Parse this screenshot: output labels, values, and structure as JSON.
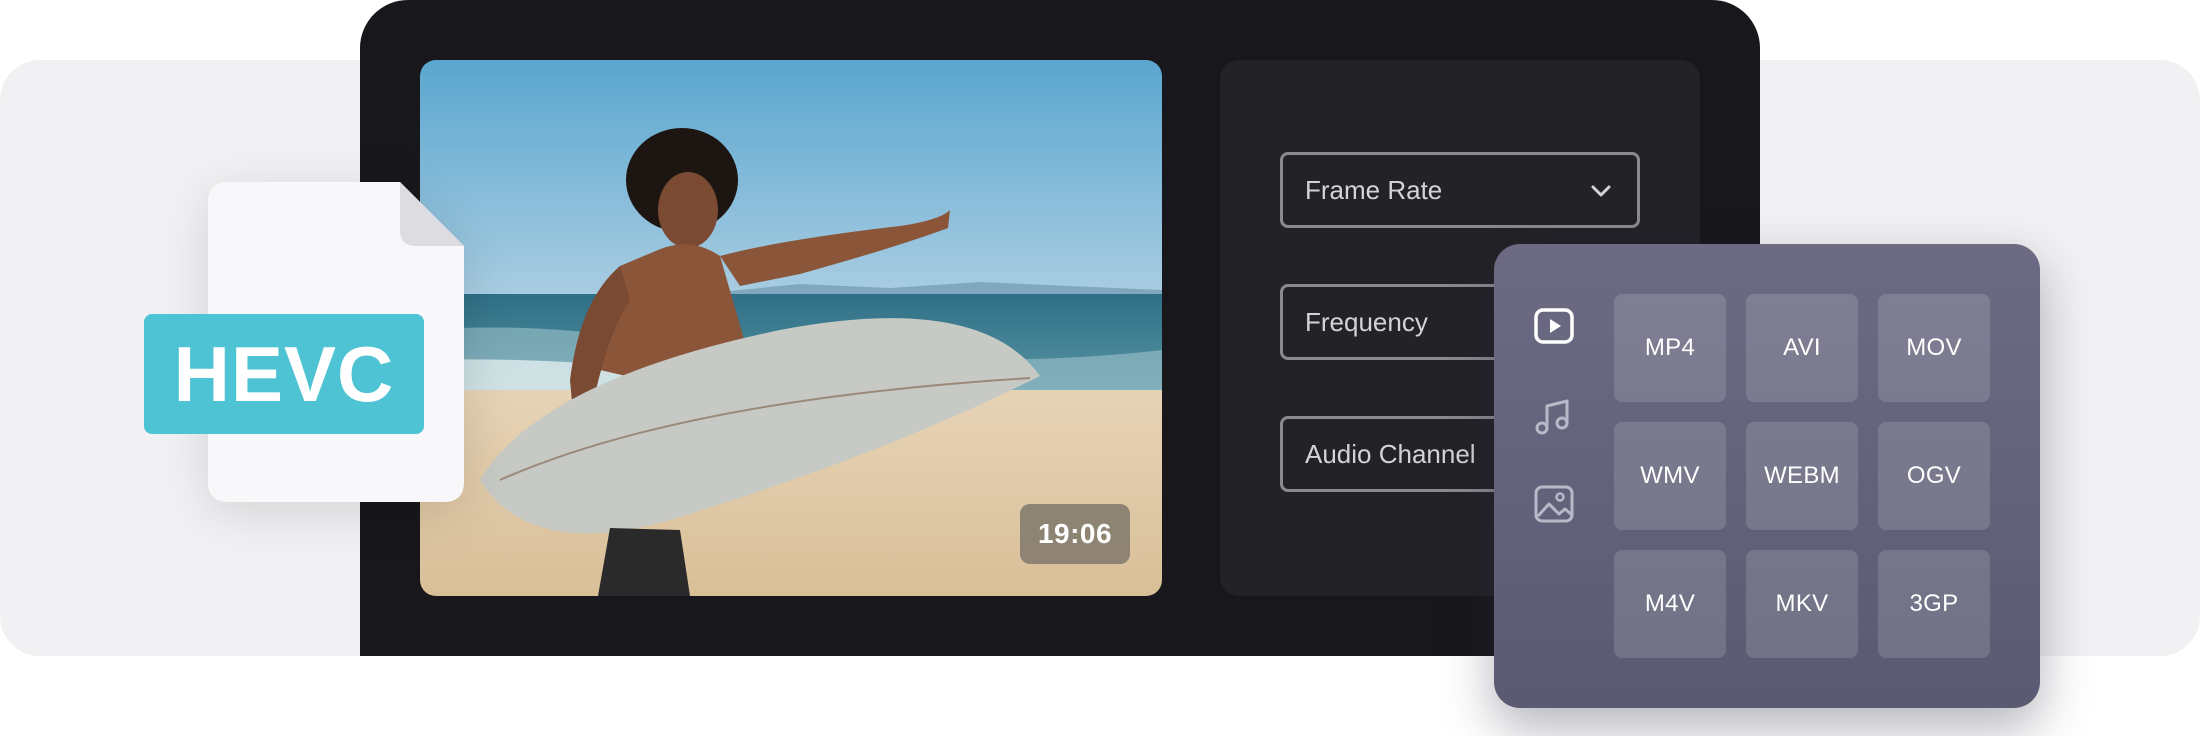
{
  "preview": {
    "timestamp": "19:06"
  },
  "settings": {
    "fields": [
      {
        "label": "Frame Rate",
        "has_dropdown": true
      },
      {
        "label": "Frequency"
      },
      {
        "label": "Audio Channel"
      }
    ]
  },
  "format_picker": {
    "categories": [
      "video-play-icon",
      "music-note-icon",
      "image-icon"
    ],
    "formats": [
      "MP4",
      "AVI",
      "MOV",
      "WMV",
      "WEBM",
      "OGV",
      "M4V",
      "MKV",
      "3GP"
    ]
  },
  "file_badge": {
    "label": "HEVC",
    "color": "#4ec3d3"
  }
}
